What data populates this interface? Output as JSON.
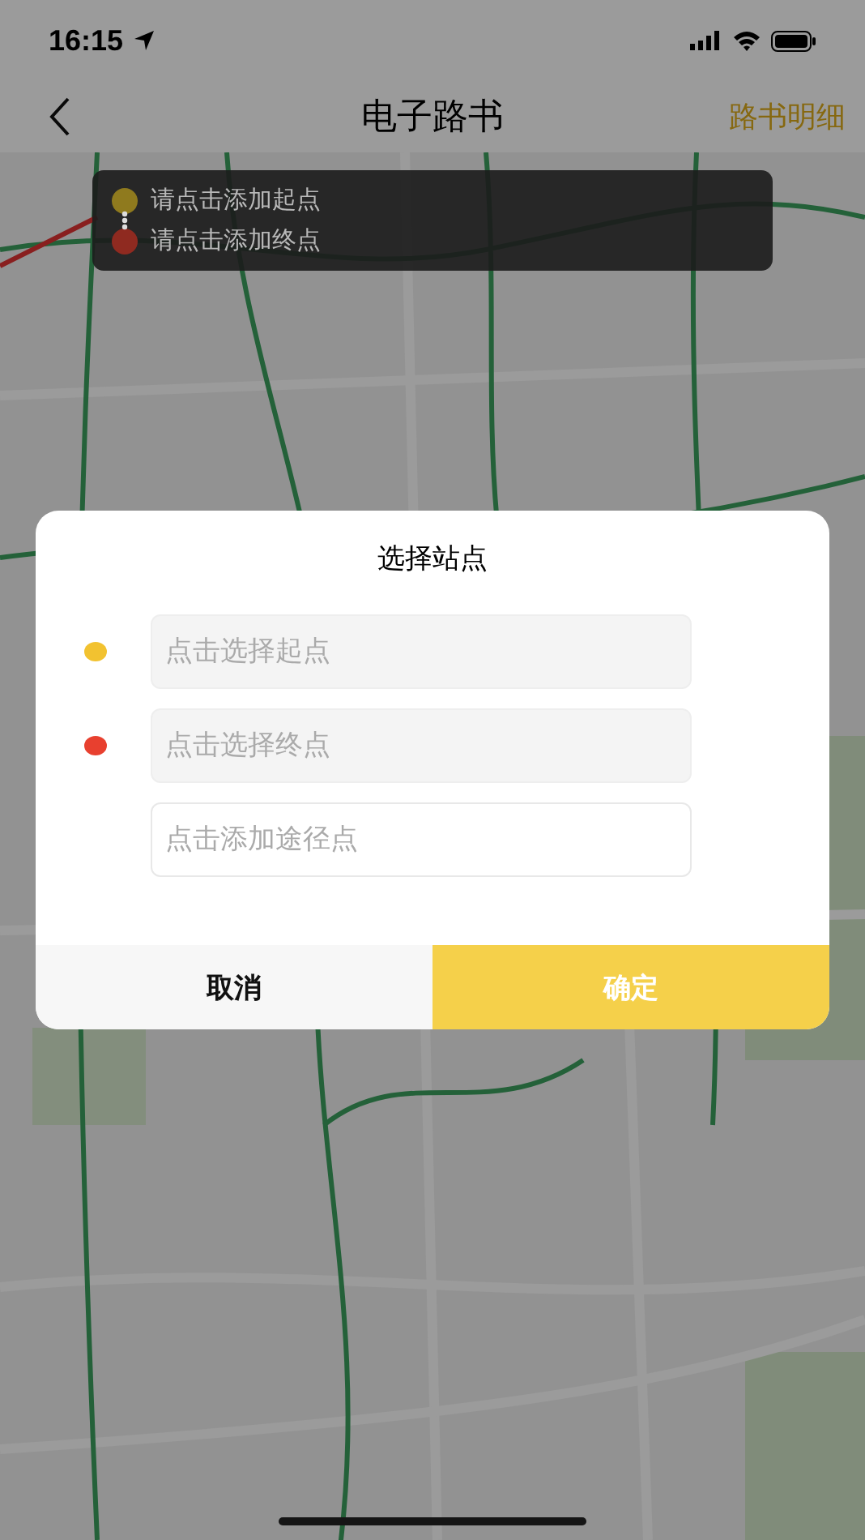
{
  "status_bar": {
    "time": "16:15"
  },
  "nav": {
    "title": "电子路书",
    "action": "路书明细"
  },
  "legend": [
    {
      "label": "请点击添加起点",
      "color": "#8f7a1e"
    },
    {
      "label": "请点击添加终点",
      "color": "#8f2a20"
    }
  ],
  "dialog": {
    "title": "选择站点",
    "fields": [
      {
        "kind": "filled",
        "placeholder": "点击选择起点",
        "color": "#f2c230"
      },
      {
        "kind": "filled",
        "placeholder": "点击选择终点",
        "color": "#e8402f"
      },
      {
        "kind": "outlined",
        "placeholder": "点击添加途径点"
      }
    ],
    "buttons": [
      {
        "kind": "cancel",
        "label": "取消"
      },
      {
        "kind": "confirm",
        "label": "确定"
      }
    ]
  }
}
